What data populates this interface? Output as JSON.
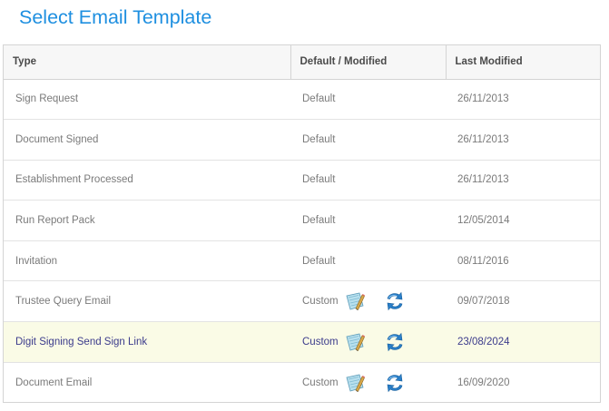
{
  "page": {
    "title": "Select Email Template"
  },
  "table": {
    "headers": {
      "type": "Type",
      "status": "Default / Modified",
      "last_modified": "Last Modified"
    },
    "rows": [
      {
        "type": "Sign Request",
        "status": "Default",
        "last_modified": "26/11/2013",
        "custom": false
      },
      {
        "type": "Document Signed",
        "status": "Default",
        "last_modified": "26/11/2013",
        "custom": false
      },
      {
        "type": "Establishment Processed",
        "status": "Default",
        "last_modified": "26/11/2013",
        "custom": false
      },
      {
        "type": "Run Report Pack",
        "status": "Default",
        "last_modified": "12/05/2014",
        "custom": false
      },
      {
        "type": "Invitation",
        "status": "Default",
        "last_modified": "08/11/2016",
        "custom": false
      },
      {
        "type": "Trustee Query Email",
        "status": "Custom",
        "last_modified": "09/07/2018",
        "custom": true
      },
      {
        "type": "Digit Signing Send Sign Link",
        "status": "Custom",
        "last_modified": "23/08/2024",
        "custom": true,
        "highlighted": true
      },
      {
        "type": "Document Email",
        "status": "Custom",
        "last_modified": "16/09/2020",
        "custom": true
      }
    ]
  },
  "icons": {
    "edit": "edit-template-icon",
    "revert": "revert-to-default-icon"
  },
  "colors": {
    "title": "#1e8fe0",
    "highlight_row": "#fafbe6",
    "highlight_text": "#3c3c8c"
  }
}
